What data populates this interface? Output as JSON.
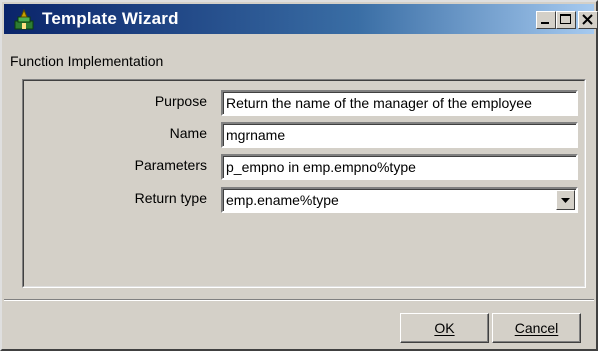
{
  "window": {
    "title": "Template Wizard",
    "controls": {
      "minimize_icon": "minimize-icon",
      "maximize_icon": "maximize-icon",
      "close_icon": "close-icon"
    },
    "title_gradient": [
      "#0a246a",
      "#a6caf0"
    ]
  },
  "section": {
    "title": "Function Implementation"
  },
  "form": {
    "fields": [
      {
        "label": "Purpose",
        "value": "Return the name of the manager of the employee"
      },
      {
        "label": "Name",
        "value": "mgrname"
      },
      {
        "label": "Parameters",
        "value": "p_empno in emp.empno%type"
      },
      {
        "label": "Return type",
        "value": "emp.ename%type",
        "type": "select"
      }
    ]
  },
  "buttons": {
    "ok": "OK",
    "cancel": "Cancel"
  }
}
